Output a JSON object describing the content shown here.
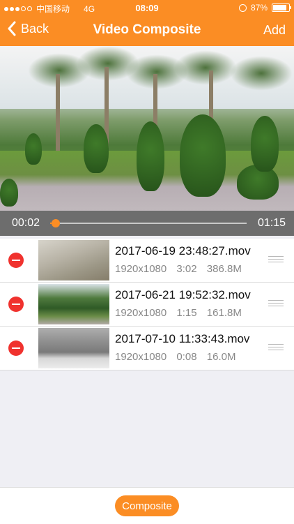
{
  "status_bar": {
    "carrier": "中国移动",
    "network": "4G",
    "time": "08:09",
    "battery": "87%",
    "battery_level": 0.87
  },
  "nav": {
    "back_label": "Back",
    "title": "Video Composite",
    "add_label": "Add"
  },
  "player": {
    "current_time": "00:02",
    "duration": "01:15",
    "progress": 0.03
  },
  "videos": [
    {
      "name": "2017-06-19 23:48:27.mov",
      "resolution": "1920x1080",
      "length": "3:02",
      "size": "386.8M"
    },
    {
      "name": "2017-06-21 19:52:32.mov",
      "resolution": "1920x1080",
      "length": "1:15",
      "size": "161.8M"
    },
    {
      "name": "2017-07-10 11:33:43.mov",
      "resolution": "1920x1080",
      "length": "0:08",
      "size": "16.0M"
    }
  ],
  "actions": {
    "composite_label": "Composite"
  },
  "colors": {
    "accent": "#fb8d24",
    "delete": "#f0322e"
  }
}
